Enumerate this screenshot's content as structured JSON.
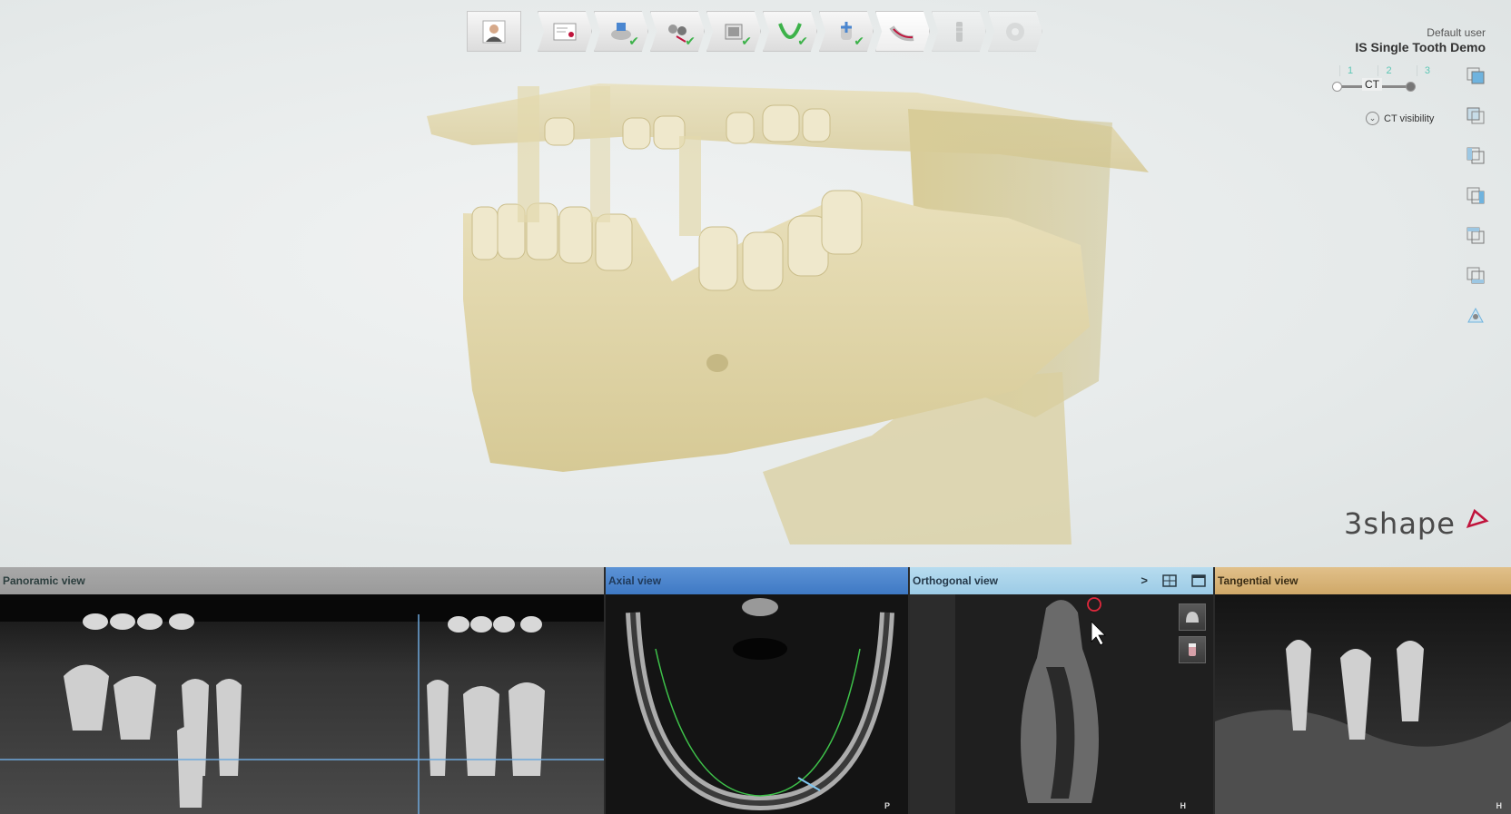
{
  "workflow": {
    "steps": [
      {
        "id": "patient",
        "icon": "patient-photo-icon",
        "done": false
      },
      {
        "id": "order-form",
        "icon": "order-form-icon",
        "done": false
      },
      {
        "id": "import-scan",
        "icon": "import-scan-icon",
        "done": true
      },
      {
        "id": "segmentation",
        "icon": "segmentation-tools-icon",
        "done": true
      },
      {
        "id": "ct-crop",
        "icon": "ct-volume-icon",
        "done": true
      },
      {
        "id": "arch-curve",
        "icon": "arch-curve-icon",
        "done": true
      },
      {
        "id": "align",
        "icon": "alignment-icon",
        "done": true
      },
      {
        "id": "nerve",
        "icon": "nerve-canal-icon",
        "done": false
      },
      {
        "id": "implant",
        "icon": "implant-icon",
        "done": false
      },
      {
        "id": "guide",
        "icon": "surgical-guide-icon",
        "done": false
      }
    ]
  },
  "user": {
    "name": "Default user",
    "case": "IS Single Tooth Demo"
  },
  "ct_panel": {
    "ticks": [
      "1",
      "2",
      "3"
    ],
    "slider_label": "CT",
    "visibility_label": "CT visibility"
  },
  "view_tools": [
    "view-front-icon",
    "view-back-icon",
    "view-left-icon",
    "view-right-icon",
    "view-top-icon",
    "view-bottom-icon",
    "reset-view-icon"
  ],
  "brand": {
    "logo_text": "3shape"
  },
  "views": {
    "panoramic": {
      "title": "Panoramic view"
    },
    "axial": {
      "title": "Axial view",
      "corner": "P"
    },
    "orthogonal": {
      "title": "Orthogonal view",
      "next": ">",
      "corner": "H"
    },
    "tangential": {
      "title": "Tangential view",
      "corner": "H"
    }
  },
  "colors": {
    "accent_green": "#3db24a",
    "ct_teal": "#5cc7b5",
    "axial_header": "#4a86d0",
    "ortho_header": "#a8d3ea",
    "tangential_header": "#d8b475",
    "brand_red": "#c0143c"
  }
}
